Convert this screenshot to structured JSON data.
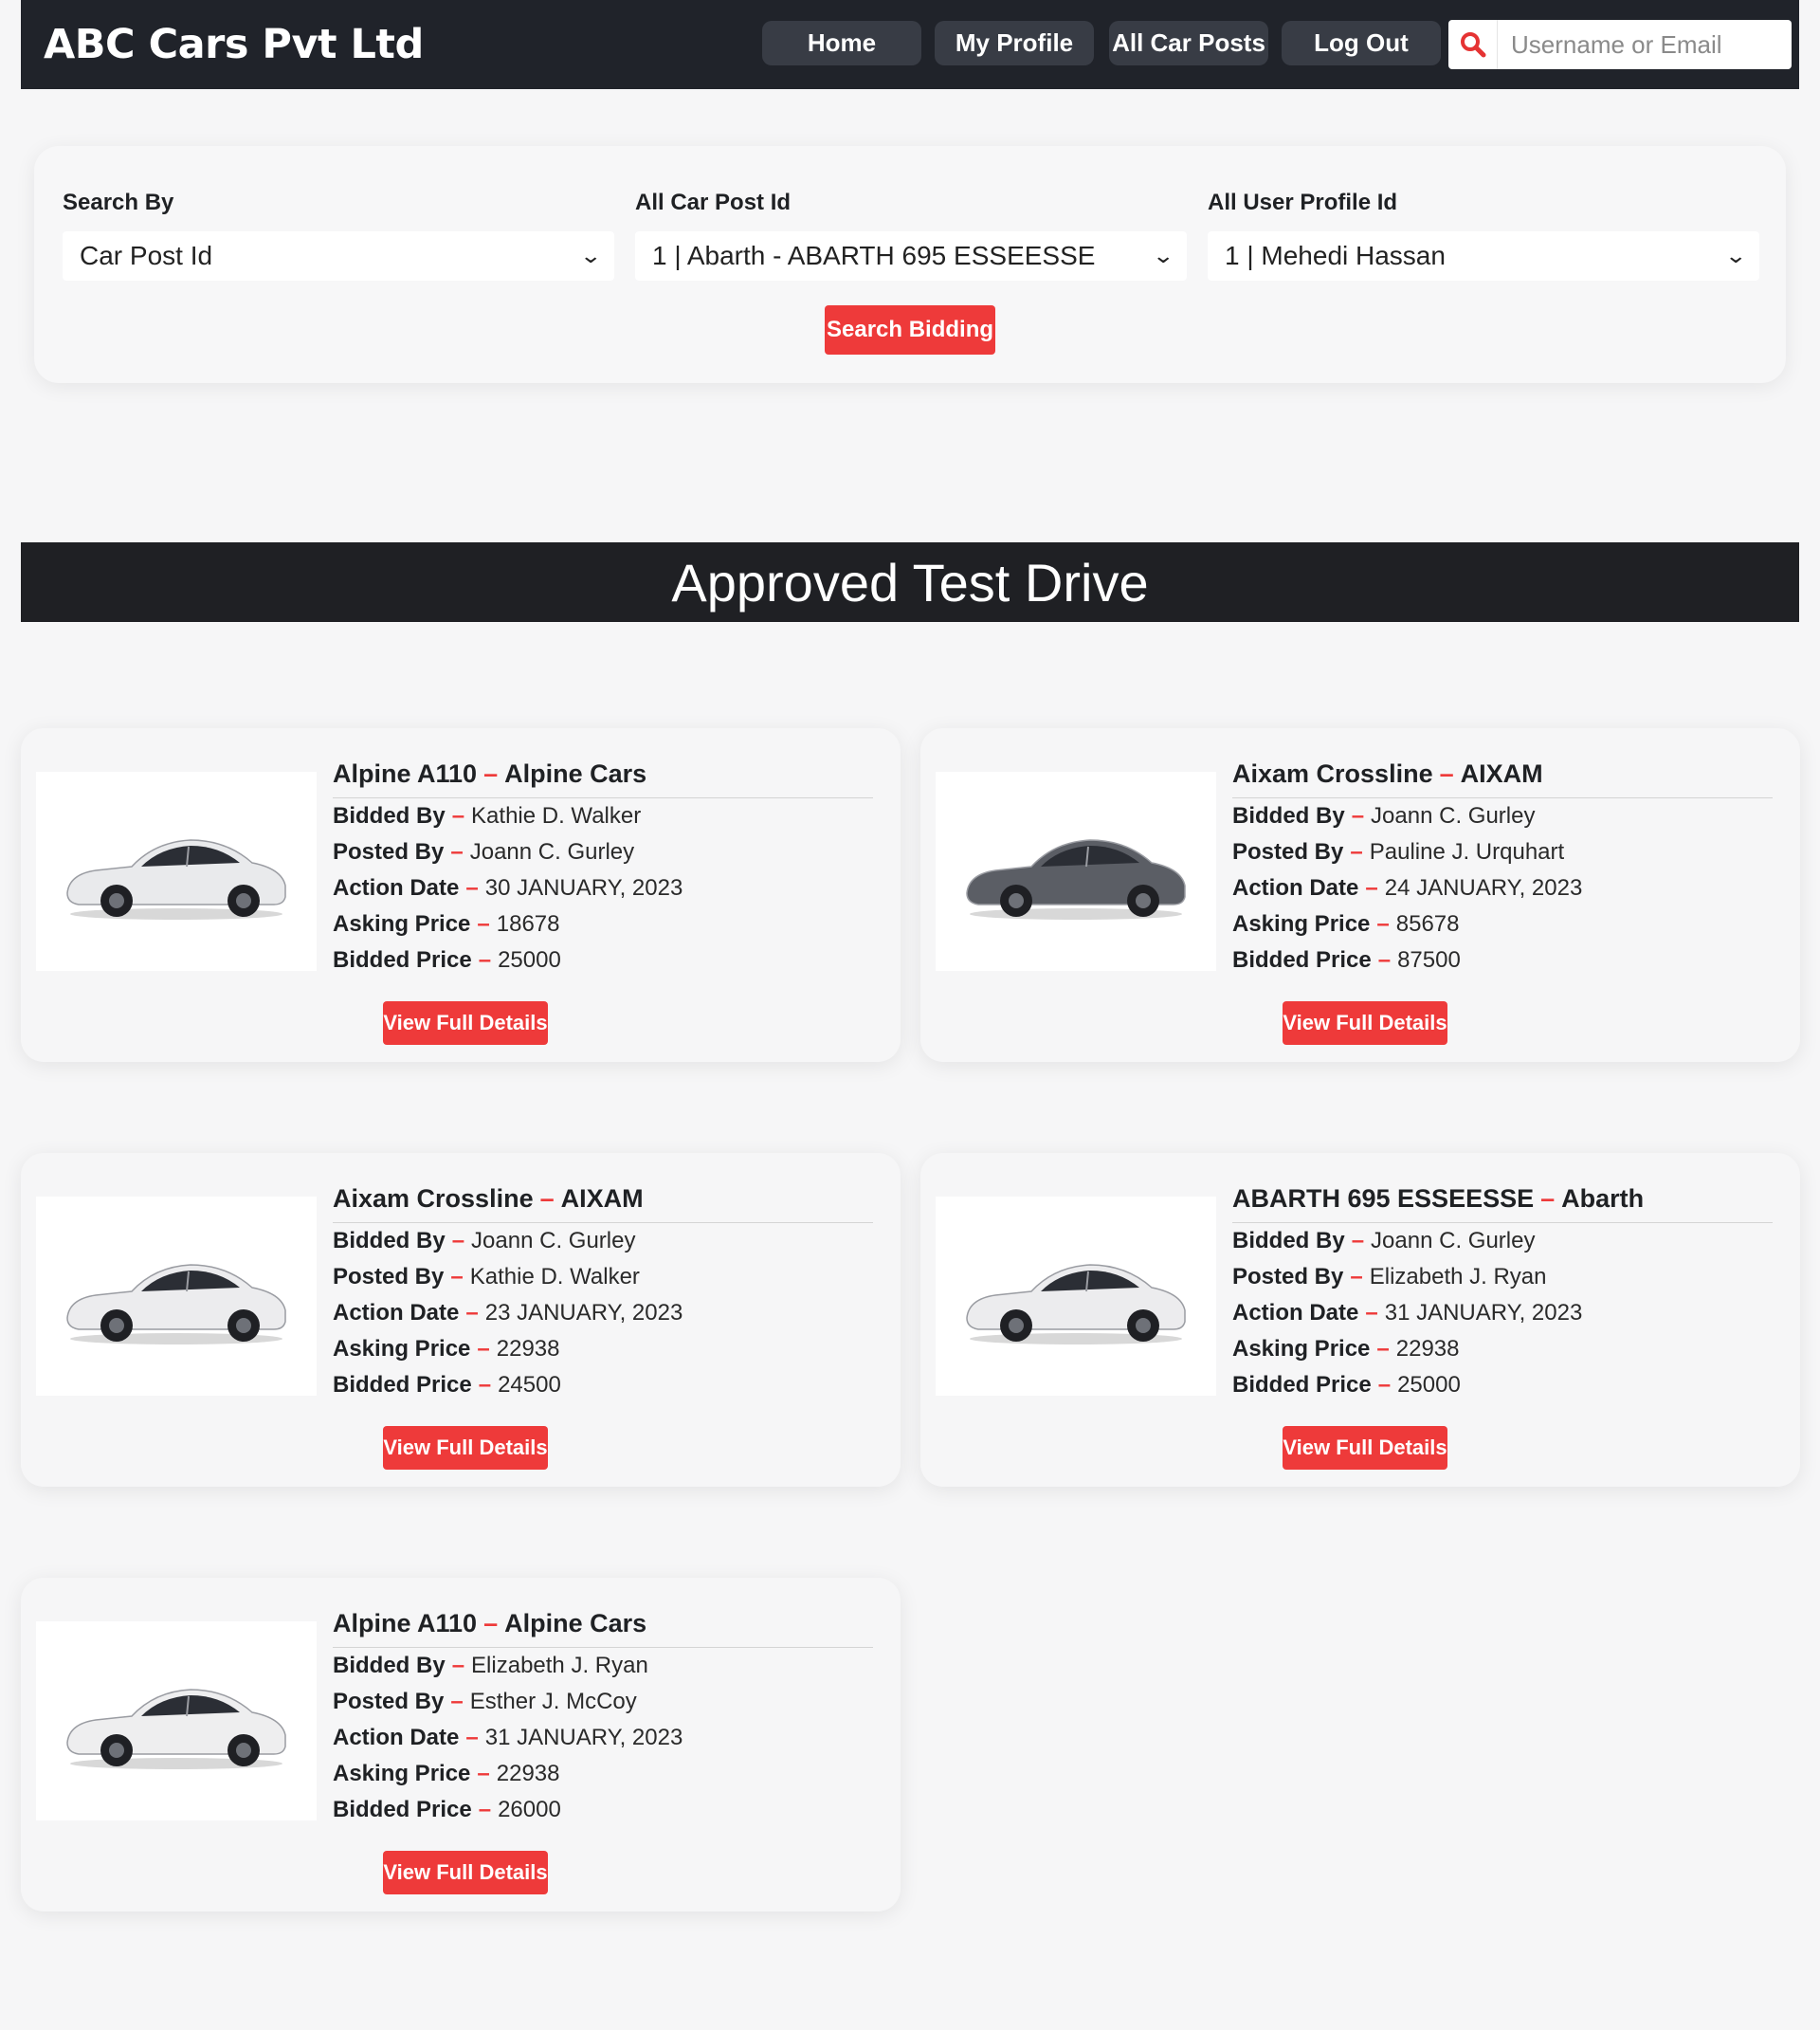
{
  "navbar": {
    "brand": "ABC Cars Pvt Ltd",
    "links": {
      "home": "Home",
      "my_profile": "My Profile",
      "all_car_posts": "All Car Posts",
      "log_out": "Log Out"
    },
    "search": {
      "icon": "search-icon",
      "placeholder": "Username or Email",
      "value": ""
    }
  },
  "filters": {
    "search_by": {
      "label": "Search By",
      "selected": "Car Post Id"
    },
    "car_post_id": {
      "label": "All Car Post Id",
      "selected": "1 | Abarth - ABARTH 695 ESSEESSE"
    },
    "user_profile_id": {
      "label": "All User Profile Id",
      "selected": "1 | Mehedi Hassan"
    },
    "search_button": "Search Bidding"
  },
  "section": {
    "title": "Approved Test Drive"
  },
  "field_labels": {
    "bidded_by": "Bidded By",
    "posted_by": "Posted By",
    "action_date": "Action Date",
    "asking_price": "Asking Price",
    "bidded_price": "Bidded Price",
    "separator": "–"
  },
  "cards": [
    {
      "model": "Alpine A110",
      "brand": "Alpine Cars",
      "bidded_by": "Kathie D. Walker",
      "posted_by": "Joann C. Gurley",
      "action_date": "30 JANUARY, 2023",
      "asking_price": "18678",
      "bidded_price": "25000",
      "button": "View Full Details",
      "car_color": "#e9eaec"
    },
    {
      "model": "Aixam Crossline",
      "brand": "AIXAM",
      "bidded_by": "Joann C. Gurley",
      "posted_by": "Pauline J. Urquhart",
      "action_date": "24 JANUARY, 2023",
      "asking_price": "85678",
      "bidded_price": "87500",
      "button": "View Full Details",
      "car_color": "#5b5e65"
    },
    {
      "model": "Aixam Crossline",
      "brand": "AIXAM",
      "bidded_by": "Joann C. Gurley",
      "posted_by": "Kathie D. Walker",
      "action_date": "23 JANUARY, 2023",
      "asking_price": "22938",
      "bidded_price": "24500",
      "button": "View Full Details",
      "car_color": "#ececee"
    },
    {
      "model": "ABARTH 695 ESSEESSE",
      "brand": "Abarth",
      "bidded_by": "Joann C. Gurley",
      "posted_by": "Elizabeth J. Ryan",
      "action_date": "31 JANUARY, 2023",
      "asking_price": "22938",
      "bidded_price": "25000",
      "button": "View Full Details",
      "car_color": "#ececee"
    },
    {
      "model": "Alpine A110",
      "brand": "Alpine Cars",
      "bidded_by": "Elizabeth J. Ryan",
      "posted_by": "Esther J. McCoy",
      "action_date": "31 JANUARY, 2023",
      "asking_price": "22938",
      "bidded_price": "26000",
      "button": "View Full Details",
      "car_color": "#eeeeef"
    }
  ],
  "colors": {
    "accent": "#ee3a3a",
    "navbar": "#20232a",
    "nav_button": "#383c45",
    "section_header": "#1f2024",
    "background": "#f6f6f7"
  }
}
